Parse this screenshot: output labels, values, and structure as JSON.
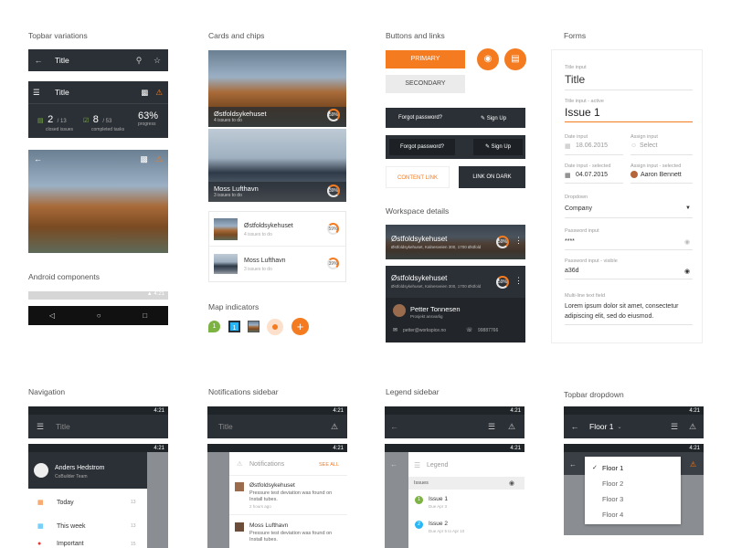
{
  "sections": {
    "topbar": "Topbar variations",
    "cards": "Cards and chips",
    "buttons": "Buttons and links",
    "forms": "Forms",
    "android": "Android components",
    "map": "Map indicators",
    "workspace": "Workspace details",
    "navigation": "Navigation",
    "notifications": "Notifications sidebar",
    "legend": "Legend sidebar",
    "dropdown": "Topbar dropdown"
  },
  "topbar1": {
    "title": "Title"
  },
  "topbar2": {
    "title": "Title",
    "stat1_value": "2",
    "stat1_total": "/ 13",
    "stat1_label": "closed issues",
    "stat2_value": "8",
    "stat2_total": "/ 53",
    "stat2_label": "completed tasks",
    "stat3_value": "63%",
    "stat3_label": "progress"
  },
  "android": {
    "time": "4:21"
  },
  "cards": [
    {
      "title": "Østfoldsykehuset",
      "sub": "4 issues to do",
      "pct": "59%"
    },
    {
      "title": "Moss Lufthavn",
      "sub": "3 issues to do",
      "pct": "39%"
    }
  ],
  "chips": [
    {
      "title": "Østfoldsykehuset",
      "sub": "4 issues to do",
      "pct": "59%"
    },
    {
      "title": "Moss Lufthavn",
      "sub": "3 issues to do",
      "pct": "39%"
    }
  ],
  "map": {
    "pin1": "1",
    "pin2": "1"
  },
  "buttons": {
    "primary": "PRIMARY",
    "secondary": "SECONDARY",
    "forgot1": "Forgot password?",
    "signup1": "Sign Up",
    "forgot2": "Forgot password?",
    "signup2": "Sign Up",
    "content_link": "CONTENT LINK",
    "link_dark": "LINK ON DARK"
  },
  "workspace": {
    "ws1_title": "Østfoldsykehuset",
    "ws1_sub": "Østfoldsykehuset, Kalnesveien 300, 1700 Østfold",
    "ws1_pct": "59%",
    "ws2_title": "Østfoldsykehuset",
    "ws2_sub": "Østfoldsykehuset, Kalnesveien 300, 1700 Østfold",
    "ws2_pct": "59%",
    "person": "Petter Tonnesen",
    "role": "Prosjekt ansvarlig",
    "email": "petter@workspice.no",
    "phone": "99887766"
  },
  "forms": {
    "title_label": "Title input",
    "title_value": "Title",
    "active_label": "Title input - active",
    "active_value": "Issue 1",
    "date_label": "Date input",
    "date_value": "18.06.2015",
    "assign_label": "Assign input",
    "assign_value": "Select",
    "date_sel_label": "Date input - selected",
    "date_sel_value": "04.07.2015",
    "assign_sel_label": "Assign input - selected",
    "assign_sel_value": "Aaron Bennett",
    "dropdown_label": "Dropdown",
    "dropdown_value": "Company",
    "pw_label": "Password input",
    "pw_value": "****",
    "pw_vis_label": "Password input - visible",
    "pw_vis_value": "a36d",
    "multi_label": "Multi-line text field",
    "multi_value": "Lorem ipsum dolor sit amet, consectetur adipiscing elit, sed do eiusmod."
  },
  "navigation": {
    "time1": "4:21",
    "time2": "4:21",
    "title": "Title",
    "user": "Anders Hedstrom",
    "team": "CoBuilder Team",
    "items": [
      {
        "label": "Today",
        "count": "13"
      },
      {
        "label": "This week",
        "count": "13"
      },
      {
        "label": "Important",
        "count": "15"
      }
    ]
  },
  "notifications": {
    "time1": "4:21",
    "time2": "4:21",
    "title": "Title",
    "header": "Notifications",
    "see_all": "SEE ALL",
    "items": [
      {
        "name": "Østfoldsykehuset",
        "text": "Pressure test deviation was found on Install tubes.",
        "time": "2 hours ago"
      },
      {
        "name": "Moss Lufthavn",
        "text": "Pressure test deviation was found on Install tubes.",
        "time": ""
      }
    ]
  },
  "legend": {
    "time1": "4:21",
    "time2": "4:21",
    "header": "Legend",
    "group": "Issues",
    "items": [
      {
        "label": "Issue 1",
        "date": "Due Apr 3",
        "num": "1",
        "color": "#7cb342"
      },
      {
        "label": "Issue 2",
        "date": "Due Apr 5 to Apr 10",
        "num": "2",
        "color": "#29b6f6"
      }
    ]
  },
  "dropdown": {
    "time1": "4:21",
    "time2": "4:21",
    "title": "Floor 1",
    "items": [
      "Floor 1",
      "Floor 2",
      "Floor 3",
      "Floor 4"
    ]
  },
  "colors": {
    "accent": "#f47b20",
    "dark": "#2b3036"
  }
}
